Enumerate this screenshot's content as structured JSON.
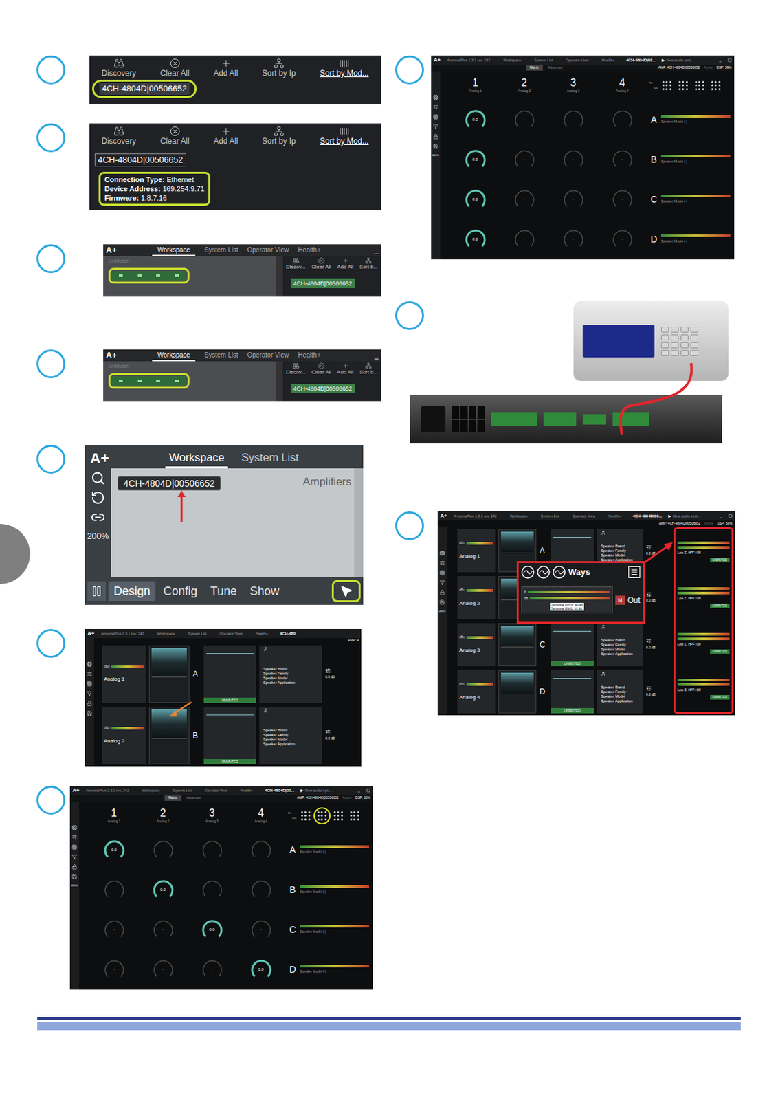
{
  "step1": {
    "toolbar": [
      {
        "label": "Discovery",
        "selected": false
      },
      {
        "label": "Clear All",
        "selected": false
      },
      {
        "label": "Add All",
        "selected": false
      },
      {
        "label": "Sort by Ip",
        "selected": false
      },
      {
        "label": "Sort by Mod...",
        "selected": true
      }
    ],
    "device": "4CH-4804D|00506652",
    "device_highlighted": true
  },
  "step2": {
    "toolbar": [
      {
        "label": "Discovery",
        "selected": false
      },
      {
        "label": "Clear All",
        "selected": false
      },
      {
        "label": "Add All",
        "selected": false
      },
      {
        "label": "Sort by Ip",
        "selected": false
      },
      {
        "label": "Sort by Mod...",
        "selected": true
      }
    ],
    "device": "4CH-4804D|00506652",
    "info": [
      {
        "label": "Connection Type:",
        "value": "Ethernet"
      },
      {
        "label": "Device Address:",
        "value": "169.254.9.71"
      },
      {
        "label": "Firmware:",
        "value": "1.8.7.16"
      }
    ],
    "info_highlighted": true
  },
  "step3": {
    "logo": "A+",
    "tabs": [
      {
        "label": "Workspace",
        "selected": true
      },
      {
        "label": "System List",
        "selected": false
      },
      {
        "label": "Operator View",
        "selected": false
      },
      {
        "label": "Health+",
        "selected": false
      }
    ],
    "minimize": "_",
    "unmatch": "UnMatch",
    "amp_highlighted": true,
    "toolbar": [
      "Discov...",
      "Clear All",
      "Add All",
      "Sort b..."
    ],
    "device": "4CH-4804D|00506652"
  },
  "step4": {
    "logo": "A+",
    "tabs": [
      {
        "label": "Workspace",
        "selected": true
      },
      {
        "label": "System List",
        "selected": false
      },
      {
        "label": "Operator View",
        "selected": false
      },
      {
        "label": "Health+",
        "selected": false
      }
    ],
    "minimize": "_",
    "unmatch": "UnMatch",
    "amp_highlighted": true,
    "toolbar": [
      "Discov...",
      "Clear All",
      "Add All",
      "Sort b..."
    ],
    "device": "4CH-4804D|00506652"
  },
  "step5": {
    "logo": "A+",
    "tabs": [
      {
        "label": "Workspace",
        "selected": true
      },
      {
        "label": "System List",
        "selected": false
      }
    ],
    "zoom": "200%",
    "device": "4CH-4804D|00506652",
    "section": "Amplifiers",
    "modes": [
      {
        "label": "Design",
        "selected": true
      },
      {
        "label": "Config",
        "selected": false
      },
      {
        "label": "Tune",
        "selected": false
      },
      {
        "label": "Show",
        "selected": false
      }
    ],
    "pointer_highlighted": true
  },
  "step6": {
    "logo": "A+",
    "app": "ArmoniaPlus 1.3.1 rev. 242",
    "tabs": [
      "Workspace",
      "System List",
      "Operator View",
      "Health+"
    ],
    "device_tab": "4CH-480",
    "amp": "AMP: 4",
    "meter_unit": "dBu",
    "channels": [
      {
        "input": "Analog 1",
        "output": "A",
        "status": "UNMUTED",
        "speaker": [
          "Speaker Brand",
          "Speaker Family",
          "Speaker Model",
          "Speaker Application"
        ],
        "gain": "0.0 dB",
        "pointed": false
      },
      {
        "input": "Analog 2",
        "output": "B",
        "status": "UNMUTED",
        "speaker": [
          "Speaker Brand",
          "Speaker Family",
          "Speaker Model",
          "Speaker Application"
        ],
        "gain": "0.0 dB",
        "pointed": true
      }
    ]
  },
  "step7": {
    "logo": "A+",
    "app": "ArmoniaPlus 1.3.1 rev. 242",
    "tabs": [
      "Workspace",
      "System List",
      "Operator View",
      "Health+"
    ],
    "device_tab": "4CH-4804D|00...",
    "sync_icon": "▶",
    "sync": "New audio syst...",
    "minimize": "_",
    "zoom": "200%",
    "subtabs": [
      {
        "label": "Matrix",
        "selected": true
      },
      {
        "label": "Advanced",
        "selected": false
      }
    ],
    "amp": "AMP: 4CH-4804D|00506652",
    "active": "Active",
    "dsp": "DSP: 60%",
    "preset_labels": [
      "No",
      "Spk"
    ],
    "presets": [
      {
        "selected": false
      },
      {
        "selected": true
      },
      {
        "selected": false
      },
      {
        "selected": false
      }
    ],
    "inputs": [
      {
        "number": "1",
        "name": "Analog 1"
      },
      {
        "number": "2",
        "name": "Analog 2"
      },
      {
        "number": "3",
        "name": "Analog 3"
      },
      {
        "number": "4",
        "name": "Analog 4"
      }
    ],
    "rows": [
      {
        "output": "A",
        "speaker": "Speaker Model (-)",
        "knobs": [
          {
            "value": "0.0",
            "on": true
          },
          {
            "value": "-",
            "on": false
          },
          {
            "value": "-",
            "on": false
          },
          {
            "value": "-",
            "on": false
          }
        ]
      },
      {
        "output": "B",
        "speaker": "Speaker Model (-)",
        "knobs": [
          {
            "value": "-",
            "on": false
          },
          {
            "value": "0.0",
            "on": true
          },
          {
            "value": "-",
            "on": false
          },
          {
            "value": "-",
            "on": false
          }
        ]
      },
      {
        "output": "C",
        "speaker": "Speaker Model (-)",
        "knobs": [
          {
            "value": "-",
            "on": false
          },
          {
            "value": "-",
            "on": false
          },
          {
            "value": "0.0",
            "on": true
          },
          {
            "value": "-",
            "on": false
          }
        ]
      },
      {
        "output": "D",
        "speaker": "Speaker Model (-)",
        "knobs": [
          {
            "value": "-",
            "on": false
          },
          {
            "value": "-",
            "on": false
          },
          {
            "value": "-",
            "on": false
          },
          {
            "value": "0.0",
            "on": true
          }
        ]
      }
    ]
  },
  "step8": {
    "logo": "A+",
    "app": "ArmoniaPlus 1.3.1 rev. 242",
    "tabs": [
      "Workspace",
      "System List",
      "Operator View",
      "Health+"
    ],
    "device_tab": "4CH-4804D|00...",
    "sync_icon": "▶",
    "sync": "New audio syst...",
    "minimize": "_",
    "zoom": "200%",
    "subtabs": [
      {
        "label": "Matrix",
        "selected": true
      },
      {
        "label": "Advanced",
        "selected": false
      }
    ],
    "amp": "AMP: 4CH-4804D|00506652",
    "active": "Active",
    "dsp": "DSP: 59%",
    "preset_labels": [
      "No",
      "Spk"
    ],
    "presets": [
      {
        "selected": false
      },
      {
        "selected": false
      },
      {
        "selected": false
      },
      {
        "selected": false
      }
    ],
    "inputs": [
      {
        "number": "1",
        "name": "Analog 1"
      },
      {
        "number": "2",
        "name": "Analog 2"
      },
      {
        "number": "3",
        "name": "Analog 3"
      },
      {
        "number": "4",
        "name": "Analog 4"
      }
    ],
    "rows": [
      {
        "output": "A",
        "speaker": "Speaker Model (-)",
        "knobs": [
          {
            "value": "0.0",
            "on": true
          },
          {
            "value": "-",
            "on": false
          },
          {
            "value": "-",
            "on": false
          },
          {
            "value": "-",
            "on": false
          }
        ]
      },
      {
        "output": "B",
        "speaker": "Speaker Model (-)",
        "knobs": [
          {
            "value": "0.0",
            "on": true
          },
          {
            "value": "-",
            "on": false
          },
          {
            "value": "-",
            "on": false
          },
          {
            "value": "-",
            "on": false
          }
        ]
      },
      {
        "output": "C",
        "speaker": "Speaker Model (-)",
        "knobs": [
          {
            "value": "0.0",
            "on": true
          },
          {
            "value": "-",
            "on": false
          },
          {
            "value": "-",
            "on": false
          },
          {
            "value": "-",
            "on": false
          }
        ]
      },
      {
        "output": "D",
        "speaker": "Speaker Model (-)",
        "knobs": [
          {
            "value": "0.0",
            "on": true
          },
          {
            "value": "-",
            "on": false
          },
          {
            "value": "-",
            "on": false
          },
          {
            "value": "-",
            "on": false
          }
        ]
      }
    ]
  },
  "step10": {
    "logo": "A+",
    "app": "ArmoniaPlus 1.3.1 rev. 242",
    "tabs": [
      "Workspace",
      "System List",
      "Operator View",
      "Health+"
    ],
    "device_tab": "4CH-4804D|00...",
    "sync_icon": "▶",
    "sync": "New audio syst...",
    "minimize": "_",
    "zoom": "200%",
    "amp": "AMP: 4CH-4804D|00506652",
    "active": "Active",
    "dsp": "DSP: 59%",
    "meter_unit": "dBu",
    "channels": [
      {
        "input": "Analog 1",
        "output": "A",
        "status": "UNMUTED",
        "speaker": [
          "Speaker Brand",
          "Speaker Family",
          "Speaker Model",
          "Speaker Application"
        ],
        "gain": "0.0 dB",
        "limiter": "Low Z, HPF: Off",
        "out_status": "UNMUTED"
      },
      {
        "input": "Analog 2",
        "output": "B",
        "status": "UNMUTED",
        "speaker": [
          "Speaker Brand",
          "Speaker Family",
          "Speaker Model",
          "Speaker Application"
        ],
        "gain": "0.0 dB",
        "limiter": "Low Z, HPF: Off",
        "out_status": "UNMUTED"
      },
      {
        "input": "Analog 3",
        "output": "C",
        "status": "UNMUTED",
        "speaker": [
          "Speaker Brand",
          "Speaker Family",
          "Speaker Model",
          "Speaker Application"
        ],
        "gain": "0.0 dB",
        "limiter": "Low Z, HPF: Off",
        "out_status": "UNMUTED"
      },
      {
        "input": "Analog 4",
        "output": "D",
        "status": "UNMUTED",
        "speaker": [
          "Speaker Brand",
          "Speaker Family",
          "Speaker Model",
          "Speaker Application"
        ],
        "gain": "0.0 dB",
        "limiter": "Low Z, HPF: Off",
        "out_status": "UNMUTED"
      }
    ],
    "popup": {
      "title": "Ways",
      "volt": "V",
      "db": "dB",
      "mute": "M",
      "out": "Out",
      "peak": "Tensione Picco: 43,46",
      "rms": "Tensione RMS: 30,46"
    }
  }
}
